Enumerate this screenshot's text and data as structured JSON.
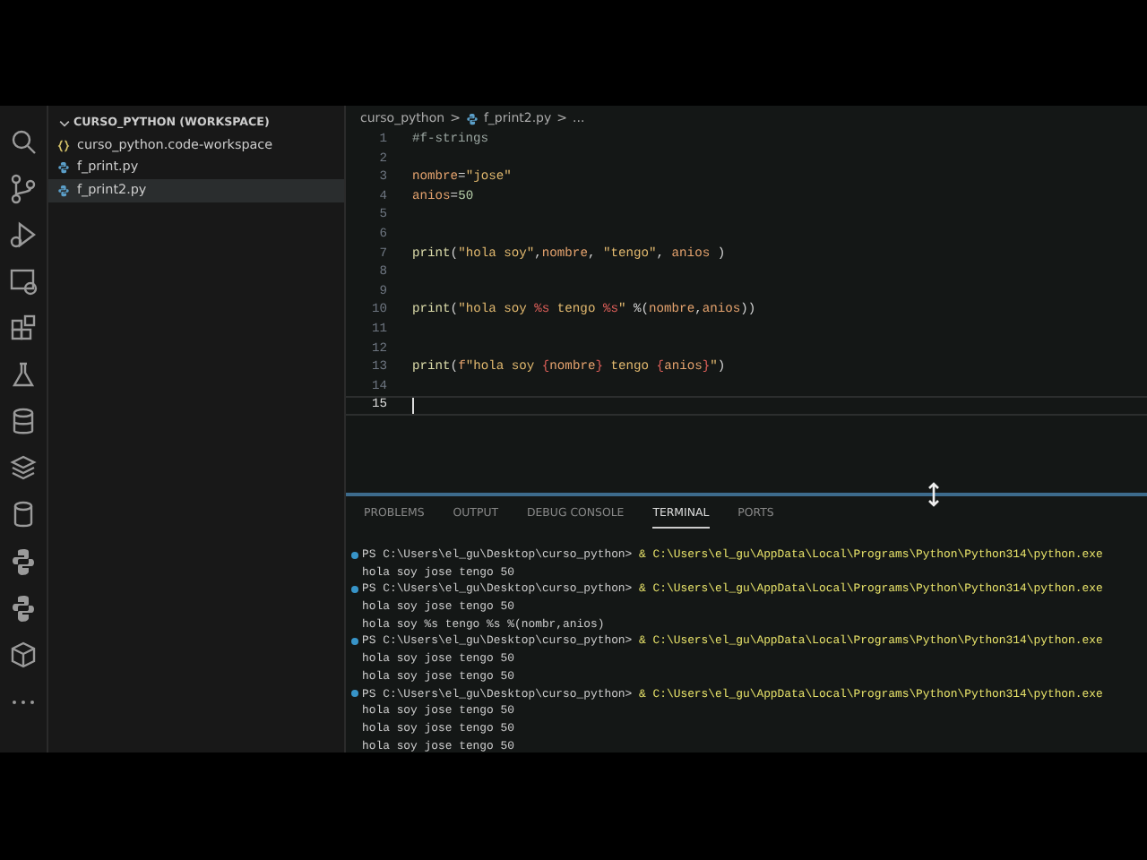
{
  "explorer": {
    "title": "CURSO_PYTHON (WORKSPACE)",
    "expanded": true,
    "items": [
      {
        "label": "curso_python.code-workspace",
        "kind": "workspace",
        "selected": false
      },
      {
        "label": "f_print.py",
        "kind": "python",
        "selected": false
      },
      {
        "label": "f_print2.py",
        "kind": "python",
        "selected": true
      }
    ]
  },
  "breadcrumb": {
    "folder": "curso_python",
    "separator_1": ">",
    "file": "f_print2.py",
    "separator_2": ">",
    "more": "..."
  },
  "editor": {
    "lines": [
      {
        "number": "1",
        "tokens": [
          {
            "text": "#f-strings",
            "kind": "comment"
          }
        ]
      },
      {
        "number": "2"
      },
      {
        "number": "3",
        "tokens": [
          {
            "text": "nombre",
            "kind": "variable"
          },
          {
            "text": "=",
            "kind": "plain"
          },
          {
            "text": "\"jose\"",
            "kind": "string"
          }
        ]
      },
      {
        "number": "4",
        "tokens": [
          {
            "text": "anios",
            "kind": "variable"
          },
          {
            "text": "=",
            "kind": "plain"
          },
          {
            "text": "50",
            "kind": "number"
          }
        ]
      },
      {
        "number": "5"
      },
      {
        "number": "6"
      },
      {
        "number": "7",
        "tokens": [
          {
            "text": "print",
            "kind": "function"
          },
          {
            "text": "(",
            "kind": "plain"
          },
          {
            "text": "\"hola soy\"",
            "kind": "string"
          },
          {
            "text": ",",
            "kind": "plain"
          },
          {
            "text": "nombre",
            "kind": "variable"
          },
          {
            "text": ", ",
            "kind": "plain"
          },
          {
            "text": "\"tengo\"",
            "kind": "string"
          },
          {
            "text": ", ",
            "kind": "plain"
          },
          {
            "text": "anios",
            "kind": "variable"
          },
          {
            "text": " )",
            "kind": "plain"
          }
        ]
      },
      {
        "number": "8"
      },
      {
        "number": "9"
      },
      {
        "number": "10",
        "tokens": [
          {
            "text": "print",
            "kind": "function"
          },
          {
            "text": "(",
            "kind": "plain"
          },
          {
            "text": "\"hola soy ",
            "kind": "string"
          },
          {
            "text": "%s",
            "kind": "format"
          },
          {
            "text": " tengo ",
            "kind": "string"
          },
          {
            "text": "%s",
            "kind": "format"
          },
          {
            "text": "\"",
            "kind": "string"
          },
          {
            "text": " %(",
            "kind": "plain"
          },
          {
            "text": "nombre",
            "kind": "variable"
          },
          {
            "text": ",",
            "kind": "plain"
          },
          {
            "text": "anios",
            "kind": "variable"
          },
          {
            "text": "))",
            "kind": "plain"
          }
        ]
      },
      {
        "number": "11"
      },
      {
        "number": "12"
      },
      {
        "number": "13",
        "tokens": [
          {
            "text": "print",
            "kind": "function"
          },
          {
            "text": "(",
            "kind": "plain"
          },
          {
            "text": "f",
            "kind": "keyword"
          },
          {
            "text": "\"hola soy ",
            "kind": "string"
          },
          {
            "text": "{",
            "kind": "format"
          },
          {
            "text": "nombre",
            "kind": "variable"
          },
          {
            "text": "}",
            "kind": "format"
          },
          {
            "text": " tengo ",
            "kind": "string"
          },
          {
            "text": "{",
            "kind": "format"
          },
          {
            "text": "anios",
            "kind": "variable"
          },
          {
            "text": "}",
            "kind": "format"
          },
          {
            "text": "\"",
            "kind": "string"
          },
          {
            "text": ")",
            "kind": "plain"
          }
        ]
      },
      {
        "number": "14"
      },
      {
        "number": "15",
        "current": true
      }
    ]
  },
  "panel": {
    "tabs": [
      {
        "label": "PROBLEMS",
        "selected": false
      },
      {
        "label": "OUTPUT",
        "selected": false
      },
      {
        "label": "DEBUG CONSOLE",
        "selected": false
      },
      {
        "label": "TERMINAL",
        "selected": true
      },
      {
        "label": "PORTS",
        "selected": false
      }
    ],
    "terminal": [
      {
        "kind": "prompt",
        "prompt": "PS C:\\Users\\el_gu\\Desktop\\curso_python>",
        "command": "& C:\\Users\\el_gu\\AppData\\Local\\Programs\\Python\\Python314\\python.exe"
      },
      {
        "kind": "output",
        "text": "hola soy jose tengo 50"
      },
      {
        "kind": "prompt",
        "prompt": "PS C:\\Users\\el_gu\\Desktop\\curso_python>",
        "command": "& C:\\Users\\el_gu\\AppData\\Local\\Programs\\Python\\Python314\\python.exe"
      },
      {
        "kind": "output",
        "text": "hola soy jose tengo 50"
      },
      {
        "kind": "output",
        "text": "hola soy %s tengo %s %(nombr,anios)"
      },
      {
        "kind": "prompt",
        "prompt": "PS C:\\Users\\el_gu\\Desktop\\curso_python>",
        "command": "& C:\\Users\\el_gu\\AppData\\Local\\Programs\\Python\\Python314\\python.exe"
      },
      {
        "kind": "output",
        "text": "hola soy jose tengo 50"
      },
      {
        "kind": "output",
        "text": "hola soy jose tengo 50"
      },
      {
        "kind": "prompt",
        "prompt": "PS C:\\Users\\el_gu\\Desktop\\curso_python>",
        "command": "& C:\\Users\\el_gu\\AppData\\Local\\Programs\\Python\\Python314\\python.exe"
      },
      {
        "kind": "output",
        "text": "hola soy jose tengo 50"
      },
      {
        "kind": "output",
        "text": "hola soy jose tengo 50"
      },
      {
        "kind": "output",
        "text": "hola soy jose tengo 50"
      }
    ]
  }
}
